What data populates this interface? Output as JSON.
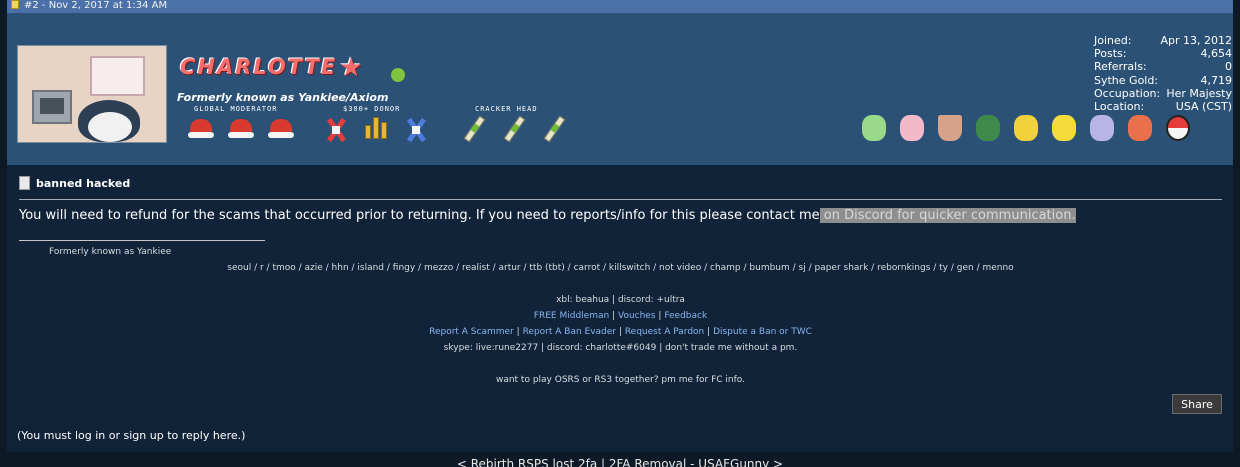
{
  "post": {
    "header": "#2 - Nov 2, 2017 at 1:34 AM",
    "username": "CHARLOTTE",
    "user_title": "Formerly known as Yankiee/Axiom",
    "badge_labels": [
      "GLOBAL MODERATOR",
      "$300+ DONOR",
      "CRACKER HEAD"
    ],
    "stats": [
      {
        "label": "Joined:",
        "value": "Apr 13, 2012"
      },
      {
        "label": "Posts:",
        "value": "4,654"
      },
      {
        "label": "Referrals:",
        "value": "0"
      },
      {
        "label": "Sythe Gold:",
        "value": "4,719"
      },
      {
        "label": "Occupation:",
        "value": "Her Majesty"
      },
      {
        "label": "Location:",
        "value": "USA (CST)"
      }
    ],
    "subject": "banned hacked",
    "message_plain": "You will need to refund for the scams that occurred prior to returning. If you need to reports/info for this please contact me",
    "message_highlight": " on Discord for quicker communication.",
    "signature": {
      "former": "Formerly known as Yankiee",
      "names": "seoul / r / tmoo / azie / hhn / island / fingy / mezzo / realist / artur / ttb (tbt) / carrot / killswitch / not video / champ / bumbum / sj / paper shark / rebornkings / ty / gen / menno",
      "contact": "xbl: beahua | discord: +ultra",
      "links1": [
        "FREE Middleman",
        "Vouches",
        "Feedback"
      ],
      "links2": [
        "Report A Scammer",
        "Report A Ban Evader",
        "Request A Pardon",
        "Dispute a Ban or TWC"
      ],
      "skype": "skype: live:rune2277 | discord: charlotte#6049 | don't trade me without a pm.",
      "osrs": "want to play OSRS or RS3 together? pm me for FC info."
    },
    "share_label": "Share",
    "login_note": "(You must log in or sign up to reply here.)"
  },
  "bottom_nav": "< Rebirth RSPS lost 2fa | 2FA Removal - USAFGunny >",
  "colors": {
    "username": "#f46d6d",
    "online": "#7fc540",
    "link": "#8ab4f0"
  }
}
